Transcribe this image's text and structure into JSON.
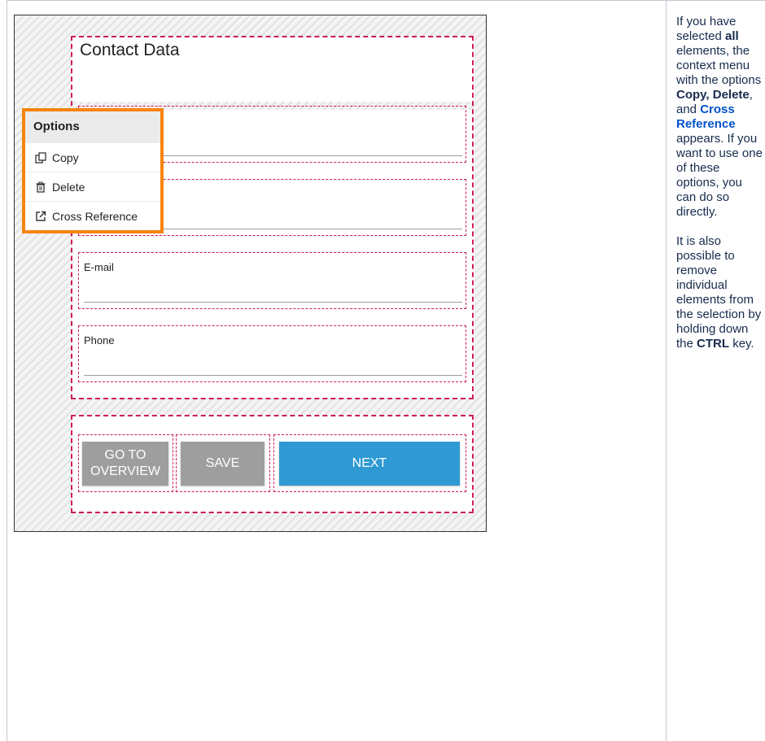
{
  "form": {
    "title": "Contact Data",
    "fields": [
      {
        "label": "E-mail"
      },
      {
        "label": "Phone"
      }
    ],
    "buttons": {
      "overview_line1": "GO TO",
      "overview_line2": "OVERVIEW",
      "save": "SAVE",
      "next": "NEXT"
    }
  },
  "context_menu": {
    "title": "Options",
    "items": [
      {
        "label": "Copy",
        "icon": "copy-icon"
      },
      {
        "label": "Delete",
        "icon": "trash-icon"
      },
      {
        "label": "Cross Reference",
        "icon": "external-link-icon"
      }
    ]
  },
  "description": {
    "p1": {
      "t1": "If you have selected ",
      "b1": "all",
      "t2": " elements, the context menu with the options ",
      "b2": "Copy,",
      "t3": " ",
      "b3": "Delete",
      "t4": ", and ",
      "link": "Cross Reference",
      "t5": " appears. If you want to use one of these options, you can do so directly."
    },
    "p2": {
      "t1": "It is also possible to remove individual elements from the selection by holding down the ",
      "b1": "CTRL",
      "t2": " key."
    }
  },
  "colors": {
    "menu_border": "#f7840e",
    "selection_dash": "#d01b56",
    "button_gray": "#9e9e9e",
    "button_blue": "#2e99d3",
    "link": "#0052cc"
  }
}
